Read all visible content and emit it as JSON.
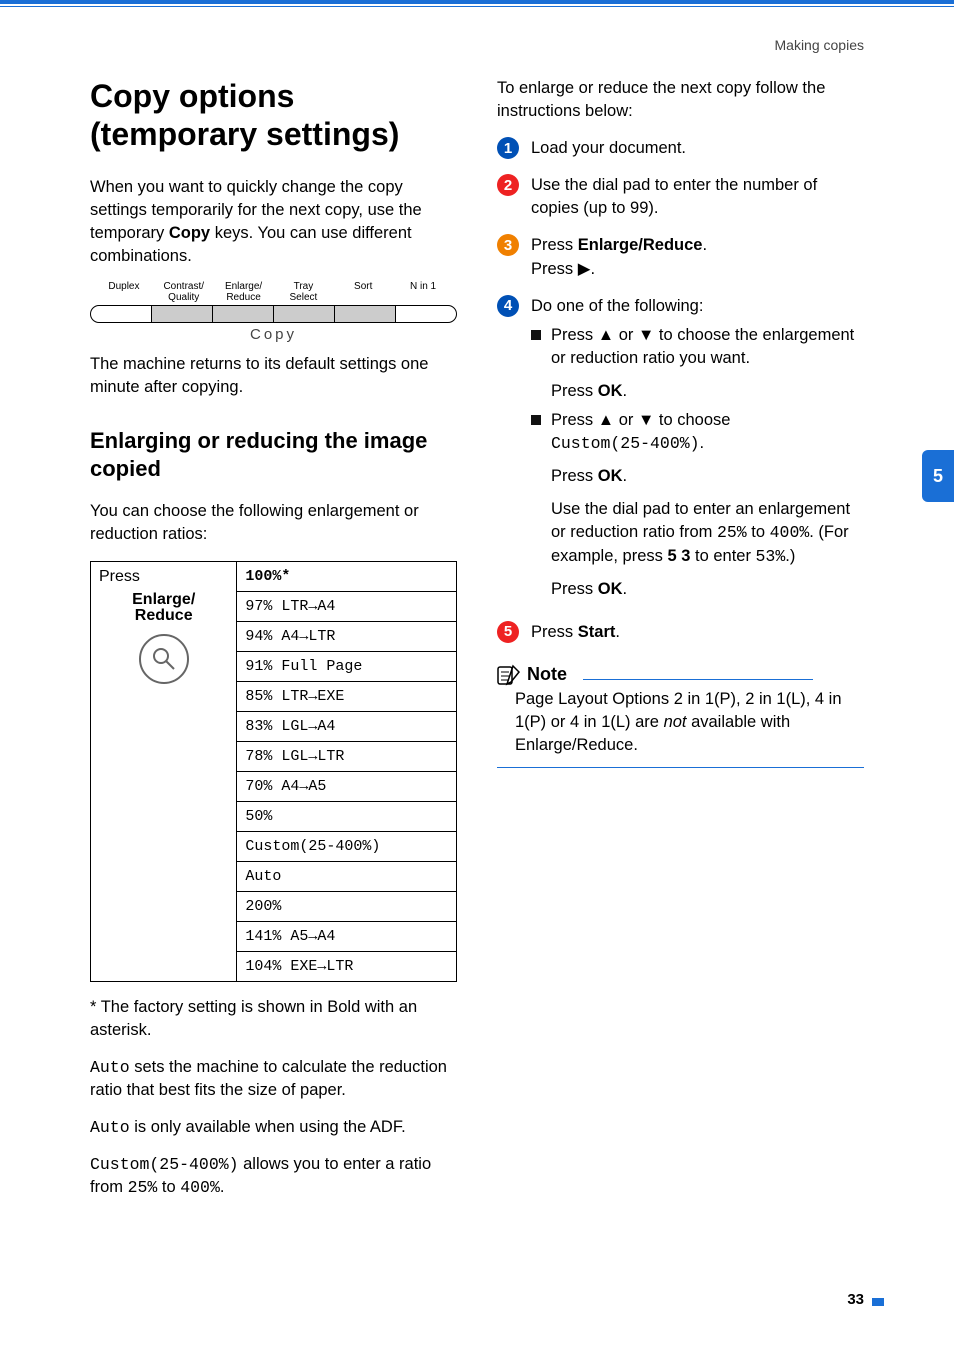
{
  "breadcrumb": "Making copies",
  "page_number": "33",
  "side_tab": "5",
  "left": {
    "h1_a": "Copy options",
    "h1_b": "(temporary settings)",
    "intro_a": "When you want to quickly change the copy settings temporarily for the next copy, use the temporary ",
    "intro_bold": "Copy",
    "intro_b": " keys. You can use different combinations.",
    "key_labels": {
      "duplex": "Duplex",
      "contrast_a": "Contrast/",
      "contrast_b": "Quality",
      "enlarge_a": "Enlarge/",
      "enlarge_b": "Reduce",
      "tray_a": "Tray",
      "tray_b": "Select",
      "sort": "Sort",
      "nin1": "N in 1"
    },
    "copy_word": "Copy",
    "returns": "The machine returns to its default settings one minute after copying.",
    "h2": "Enlarging or reducing the image copied",
    "choose": "You can choose the following enlargement or reduction ratios:",
    "table_header_press": "Press",
    "key_name_a": "Enlarge/",
    "key_name_b": "Reduce",
    "ratios": [
      "100%*",
      "97% LTR→A4",
      "94% A4→LTR",
      "91% Full Page",
      "85% LTR→EXE",
      "83% LGL→A4",
      "78% LGL→LTR",
      "70% A4→A5",
      "50%",
      "Custom(25-400%)",
      "Auto",
      "200%",
      "141% A5→A4",
      "104% EXE→LTR"
    ],
    "footnote": "* The factory setting is shown in Bold with an asterisk.",
    "auto1_a": "Auto",
    "auto1_b": " sets the machine to calculate the reduction ratio that best fits the size of paper.",
    "auto2_a": "Auto",
    "auto2_b": " is only available when using the ADF.",
    "custom_a": "Custom(25-400%)",
    "custom_b": " allows you to enter a ratio from ",
    "custom_c": "25%",
    "custom_d": " to ",
    "custom_e": "400%",
    "custom_f": "."
  },
  "right": {
    "intro": "To enlarge or reduce the next copy follow the instructions below:",
    "step1": "Load your document.",
    "step2": "Use the dial pad to enter the number of copies (up to 99).",
    "step3_a": "Press ",
    "step3_bold": "Enlarge/Reduce",
    "step3_b": ".",
    "step3_c": "Press ",
    "step3_glyph": "▶",
    "step3_d": ".",
    "step4": "Do one of the following:",
    "step4a_a": "Press ",
    "step4a_up": "▲",
    "step4a_mid": " or ",
    "step4a_down": "▼",
    "step4a_b": " to choose the enlargement or reduction ratio you want.",
    "step4a_press": "Press ",
    "step4a_ok": "OK",
    "step4a_dot": ".",
    "step4b_a": "Press ",
    "step4b_up": "▲",
    "step4b_mid": " or ",
    "step4b_down": "▼",
    "step4b_b": " to choose",
    "step4b_custom": "Custom(25-400%)",
    "step4b_dot": ".",
    "step4b_press": "Press ",
    "step4b_ok": "OK",
    "step4b_dot2": ".",
    "step4b_dial_a": "Use the dial pad to enter an enlargement or reduction ratio from ",
    "step4b_dial_25": "25%",
    "step4b_dial_to": " to ",
    "step4b_dial_400": "400%",
    "step4b_dial_b": ". (For example, press ",
    "step4b_dial_53": "5 3",
    "step4b_dial_c": " to enter ",
    "step4b_dial_53p": "53%",
    "step4b_dial_d": ".)",
    "step4b_press2": "Press ",
    "step4b_ok2": "OK",
    "step4b_dot3": ".",
    "step5_a": "Press ",
    "step5_bold": "Start",
    "step5_b": ".",
    "note_label": "Note",
    "note_a": "Page Layout Options 2 in 1(P), 2 in 1(L), 4 in 1(P) or 4 in 1(L) are ",
    "note_not": "not",
    "note_b": " available with Enlarge/Reduce."
  }
}
